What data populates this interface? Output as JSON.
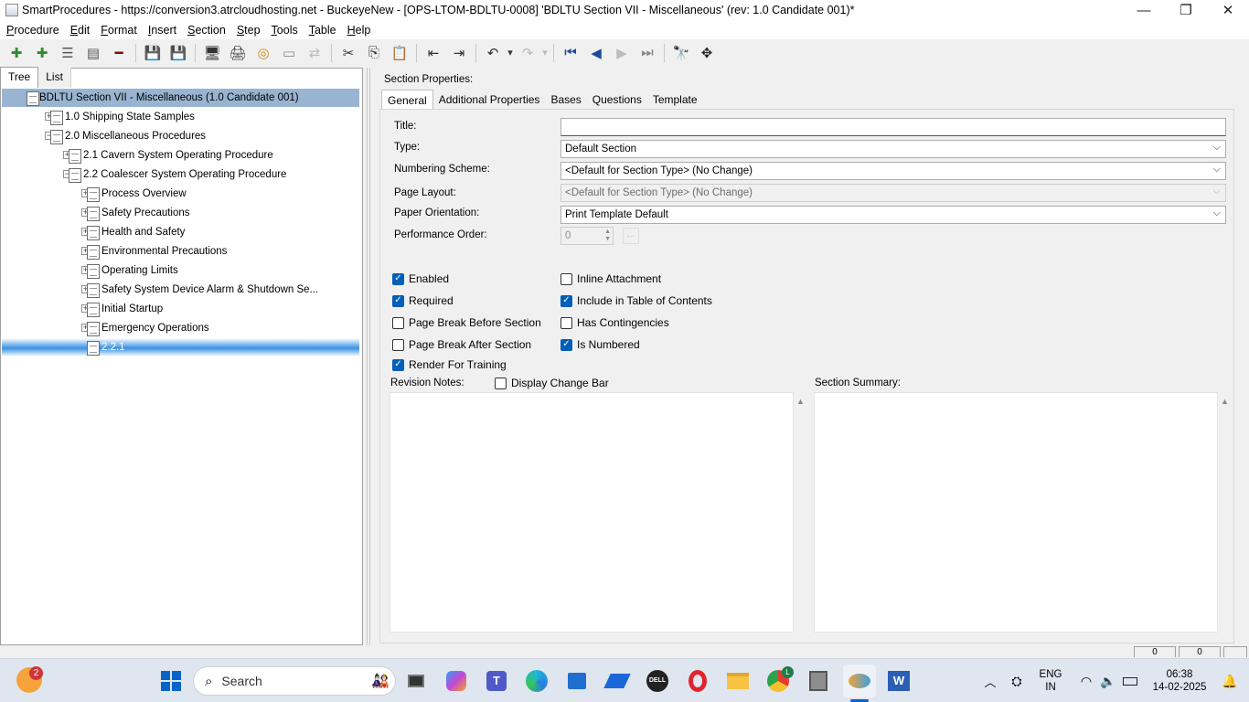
{
  "window": {
    "title": "SmartProcedures - https://conversion3.atrcloudhosting.net - BuckeyeNew - [OPS-LTOM-BDLTU-0008] 'BDLTU Section VII - Miscellaneous' (rev: 1.0 Candidate 001)*",
    "minimize": "—",
    "maximize": "❐",
    "close": "✕"
  },
  "menu": {
    "items": [
      {
        "label": "Procedure",
        "ul": "P"
      },
      {
        "label": "Edit",
        "ul": "E"
      },
      {
        "label": "Format",
        "ul": "F"
      },
      {
        "label": "Insert",
        "ul": "I"
      },
      {
        "label": "Section",
        "ul": "S"
      },
      {
        "label": "Step",
        "ul": "S"
      },
      {
        "label": "Tools",
        "ul": "T"
      },
      {
        "label": "Table",
        "ul": "T"
      },
      {
        "label": "Help",
        "ul": "H"
      }
    ]
  },
  "toolbar": {
    "icons": [
      {
        "name": "add-icon",
        "glyph": "✚",
        "color": "#2e8b2e"
      },
      {
        "name": "add-child-icon",
        "glyph": "✚",
        "color": "#2e8b2e"
      },
      {
        "name": "properties-icon",
        "glyph": "☰",
        "color": "#555"
      },
      {
        "name": "list-properties-icon",
        "glyph": "▤",
        "color": "#555"
      },
      {
        "name": "remove-icon",
        "glyph": "━",
        "color": "#7a0c0c"
      },
      {
        "name": "save-all-icon",
        "glyph": "💾",
        "color": "#1e5aa8"
      },
      {
        "name": "save-icon",
        "glyph": "💾",
        "color": "#1e5aa8"
      },
      {
        "name": "print-preview-icon",
        "glyph": "🖥",
        "color": "#333"
      },
      {
        "name": "print-icon",
        "glyph": "🖨",
        "color": "#333"
      },
      {
        "name": "spell-check-icon",
        "glyph": "◎",
        "color": "#d08a1a"
      },
      {
        "name": "comment-icon",
        "glyph": "▭",
        "color": "#888"
      },
      {
        "name": "transfer-icon",
        "glyph": "⇄",
        "color": "#bbb"
      },
      {
        "name": "cut-icon",
        "glyph": "✂",
        "color": "#333"
      },
      {
        "name": "copy-icon",
        "glyph": "⎘",
        "color": "#333"
      },
      {
        "name": "paste-icon",
        "glyph": "📋",
        "color": "#bbb"
      },
      {
        "name": "outdent-icon",
        "glyph": "⇤",
        "color": "#333"
      },
      {
        "name": "indent-icon",
        "glyph": "⇥",
        "color": "#333"
      },
      {
        "name": "undo-icon",
        "glyph": "↶",
        "color": "#333"
      },
      {
        "name": "undo-dropdown-icon",
        "glyph": "▾",
        "color": "#333"
      },
      {
        "name": "redo-icon",
        "glyph": "↷",
        "color": "#bbb"
      },
      {
        "name": "redo-dropdown-icon",
        "glyph": "▾",
        "color": "#bbb"
      },
      {
        "name": "first-icon",
        "glyph": "⏮",
        "color": "#1e4a9e"
      },
      {
        "name": "previous-icon",
        "glyph": "◀",
        "color": "#1e4a9e"
      },
      {
        "name": "next-icon",
        "glyph": "▶",
        "color": "#bbb"
      },
      {
        "name": "last-icon",
        "glyph": "⏭",
        "color": "#888"
      },
      {
        "name": "find-icon",
        "glyph": "🔭",
        "color": "#333"
      },
      {
        "name": "move-icon",
        "glyph": "✥",
        "color": "#222"
      }
    ]
  },
  "left": {
    "tabs": [
      "Tree",
      "List"
    ],
    "tree": [
      {
        "label": "BDLTU Section VII - Miscellaneous (1.0 Candidate 001)",
        "level": 0,
        "exp": "−",
        "selected": "root"
      },
      {
        "label": "1.0 Shipping State Samples",
        "level": 1,
        "exp": "+"
      },
      {
        "label": "2.0 Miscellaneous Procedures",
        "level": 1,
        "exp": "−"
      },
      {
        "label": "2.1 Cavern System Operating Procedure",
        "level": 2,
        "exp": "+"
      },
      {
        "label": "2.2 Coalescer System Operating Procedure",
        "level": 2,
        "exp": "−"
      },
      {
        "label": "Process Overview",
        "level": 3,
        "exp": "+"
      },
      {
        "label": "Safety Precautions",
        "level": 3,
        "exp": "+"
      },
      {
        "label": "Health and Safety",
        "level": 3,
        "exp": "+"
      },
      {
        "label": "Environmental Precautions",
        "level": 3,
        "exp": "+"
      },
      {
        "label": "Operating Limits",
        "level": 3,
        "exp": "+"
      },
      {
        "label": "Safety System Device Alarm & Shutdown Se...",
        "level": 3,
        "exp": "+"
      },
      {
        "label": "Initial Startup",
        "level": 3,
        "exp": "+"
      },
      {
        "label": "Emergency Operations",
        "level": 3,
        "exp": "+"
      },
      {
        "label": "2.2.1",
        "level": 3,
        "exp": "",
        "selected": "active"
      }
    ]
  },
  "right": {
    "header": "Section Properties:",
    "tabs": [
      "General",
      "Additional Properties",
      "Bases",
      "Questions",
      "Template"
    ],
    "labels": {
      "title": "Title:",
      "type": "Type:",
      "numbering": "Numbering Scheme:",
      "layout": "Page Layout:",
      "orientation": "Paper Orientation:",
      "perf": "Performance Order:",
      "revision": "Revision Notes:",
      "summary": "Section Summary:"
    },
    "values": {
      "title": "",
      "type": "Default Section",
      "numbering": "<Default for Section Type> (No Change)",
      "layout": "<Default for Section Type> (No Change)",
      "orientation": "Print Template Default",
      "perf": "0",
      "perf_btn": "..."
    },
    "checkboxes": {
      "enabled": {
        "label": "Enabled",
        "checked": true
      },
      "required": {
        "label": "Required",
        "checked": true
      },
      "pbb": {
        "label": "Page Break Before Section",
        "checked": false
      },
      "pba": {
        "label": "Page Break After Section",
        "checked": false
      },
      "rft": {
        "label": "Render For Training",
        "checked": true
      },
      "inline": {
        "label": "Inline Attachment",
        "checked": false
      },
      "toc": {
        "label": "Include in Table of Contents",
        "checked": true
      },
      "cont": {
        "label": "Has Contingencies",
        "checked": false
      },
      "num": {
        "label": "Is Numbered",
        "checked": true
      },
      "dcb": {
        "label": "Display Change Bar",
        "checked": false
      }
    }
  },
  "status": {
    "box1": "0",
    "box2": "0"
  },
  "taskbar": {
    "search": "Search",
    "badge": "2",
    "lang1": "ENG",
    "lang2": "IN",
    "time": "06:38",
    "date": "14-02-2025",
    "chrome_badge": "L"
  }
}
